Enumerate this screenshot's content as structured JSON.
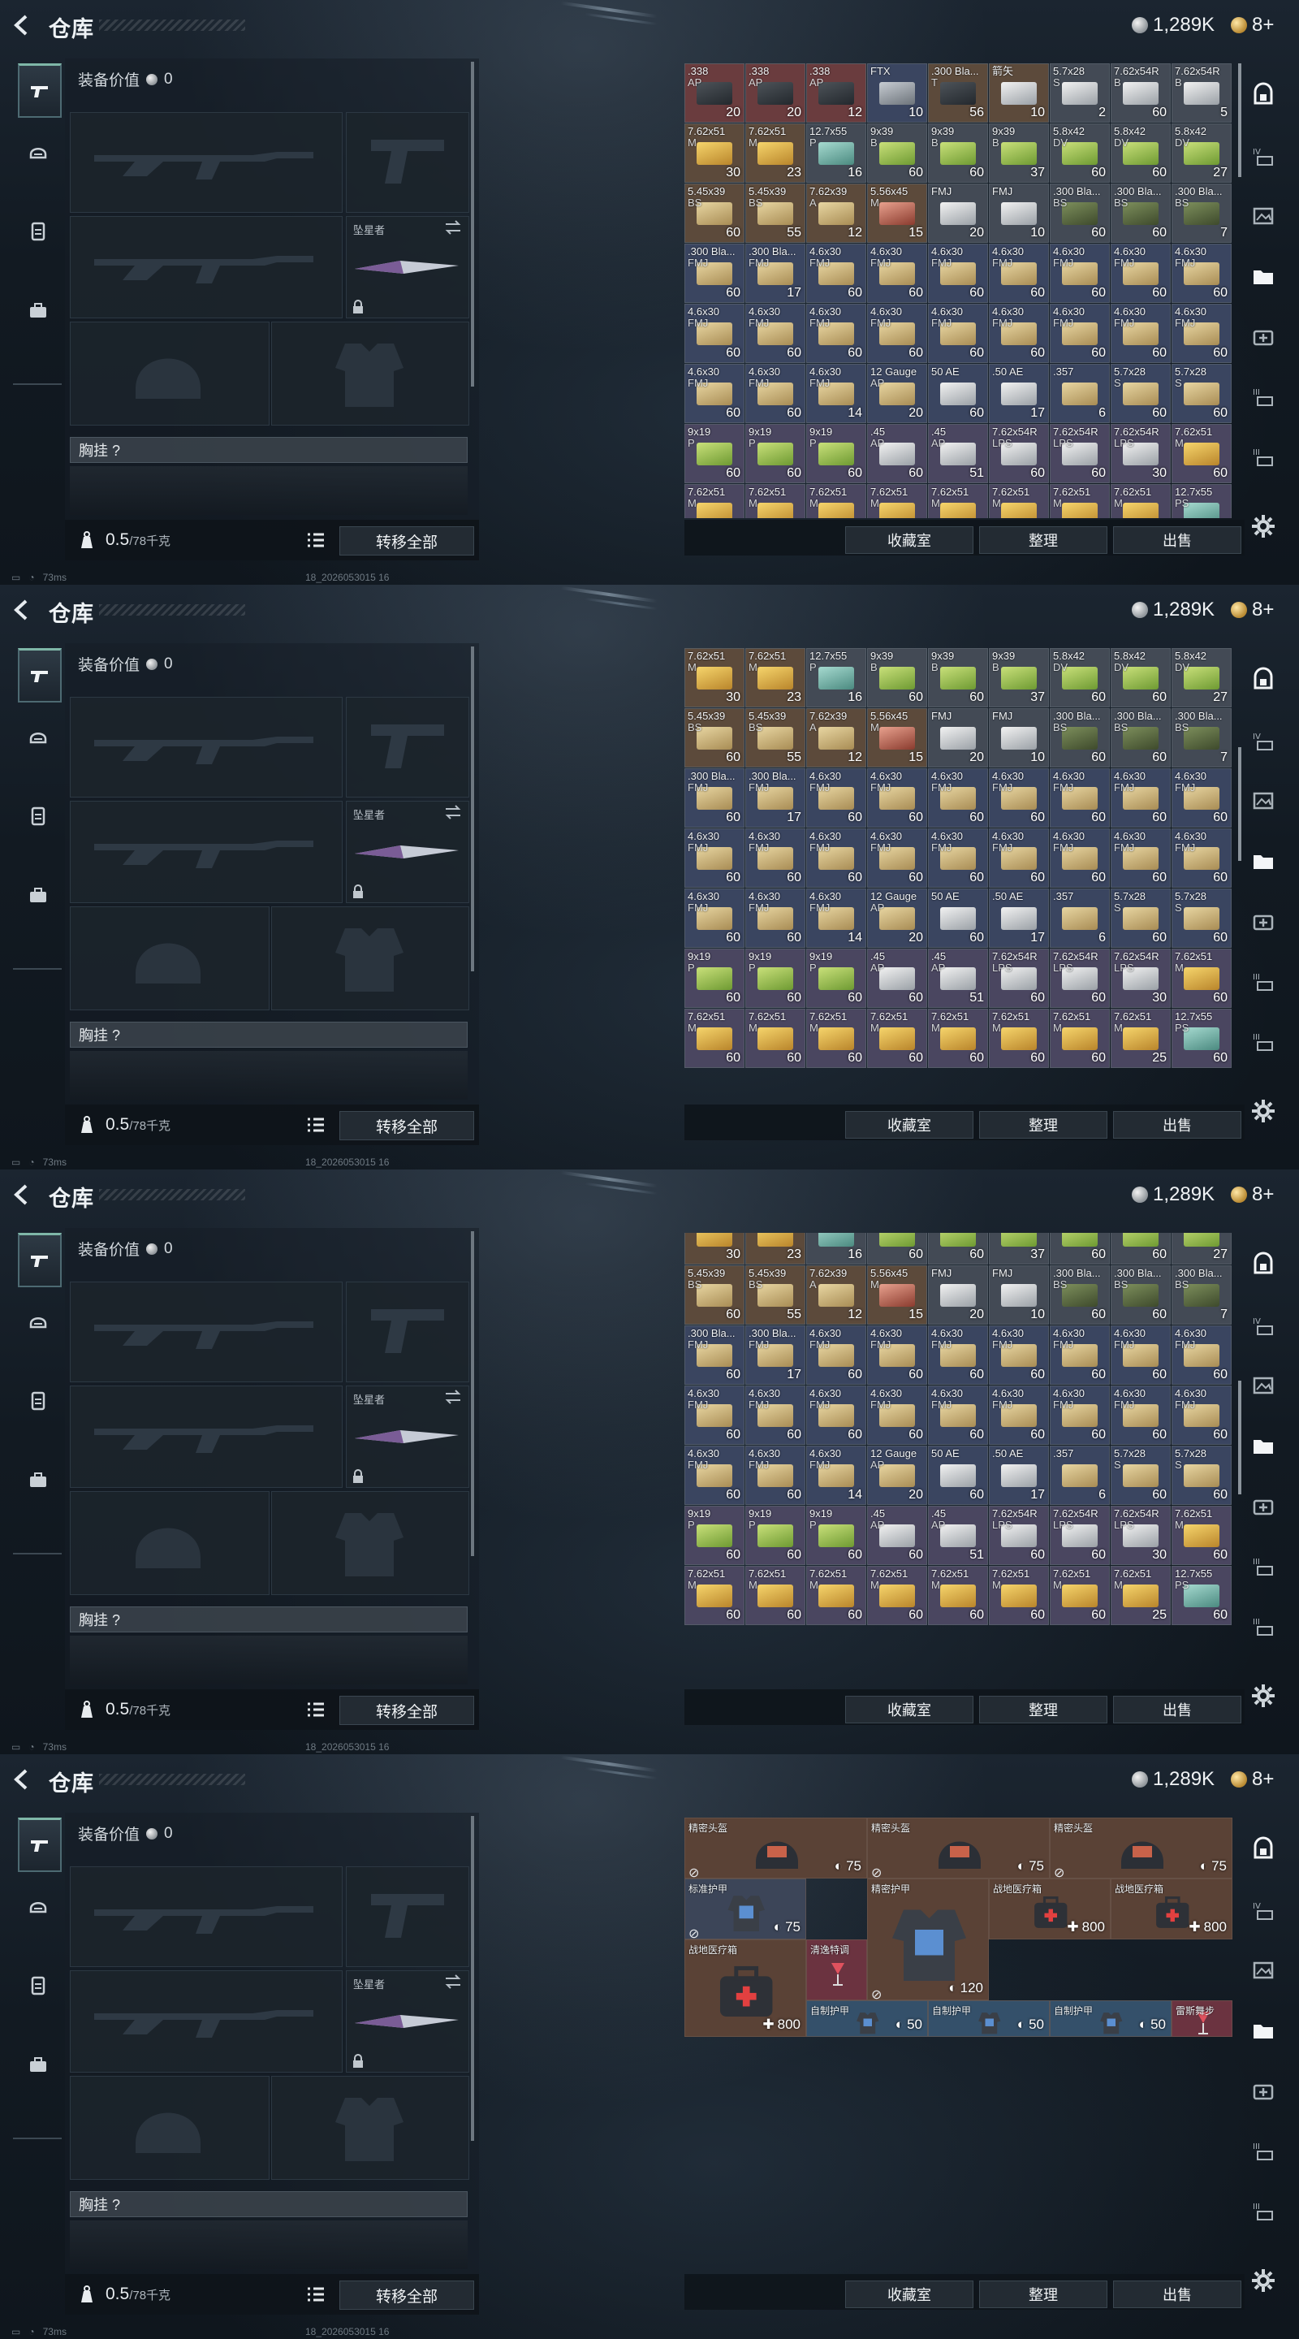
{
  "header": {
    "title": "仓库",
    "currency_silver": "1,289K",
    "currency_gold": "8+"
  },
  "loadout": {
    "value_label": "装备价值",
    "value": "0",
    "melee_name": "坠星者",
    "chest_label": "胸挂 ?",
    "weight": "0.5",
    "weight_max": "/78千克",
    "transfer_all": "转移全部"
  },
  "footer_meta": {
    "ping": "73ms",
    "build": "18_2026053015 16"
  },
  "stash_buttons": {
    "collection": "收藏室",
    "organize": "整理",
    "sell": "出售"
  },
  "ammo_rows": [
    [
      {
        "n": ".338",
        "s": "AP",
        "q": "20",
        "c": "red",
        "b": "dark"
      },
      {
        "n": ".338",
        "s": "AP",
        "q": "20",
        "c": "red",
        "b": "dark"
      },
      {
        "n": ".338",
        "s": "AP",
        "q": "12",
        "c": "red",
        "b": "dark"
      },
      {
        "n": "FTX",
        "s": "",
        "q": "10",
        "c": "blue",
        "b": "gray"
      },
      {
        "n": ".300 Bla...",
        "s": "T",
        "q": "56",
        "c": "brown",
        "b": "dark"
      },
      {
        "n": "箭矢",
        "s": "",
        "q": "10",
        "c": "brown",
        "b": "white"
      },
      {
        "n": "5.7x28",
        "s": "S",
        "q": "2",
        "c": "gray",
        "b": "white"
      },
      {
        "n": "7.62x54R",
        "s": "B",
        "q": "60",
        "c": "gray",
        "b": "white"
      },
      {
        "n": "7.62x54R",
        "s": "B",
        "q": "5",
        "c": "gray",
        "b": "white"
      }
    ],
    [
      {
        "n": "7.62x51",
        "s": "M",
        "q": "30",
        "c": "brown",
        "b": "gold"
      },
      {
        "n": "7.62x51",
        "s": "M",
        "q": "23",
        "c": "brown",
        "b": "gold"
      },
      {
        "n": "12.7x55",
        "s": "P",
        "q": "16",
        "c": "gray",
        "b": "teal"
      },
      {
        "n": "9x39",
        "s": "B",
        "q": "60",
        "c": "gray",
        "b": "green"
      },
      {
        "n": "9x39",
        "s": "B",
        "q": "60",
        "c": "gray",
        "b": "green"
      },
      {
        "n": "9x39",
        "s": "B",
        "q": "37",
        "c": "gray",
        "b": "green"
      },
      {
        "n": "5.8x42",
        "s": "DV",
        "q": "60",
        "c": "gray",
        "b": "green"
      },
      {
        "n": "5.8x42",
        "s": "DV",
        "q": "60",
        "c": "gray",
        "b": "green"
      },
      {
        "n": "5.8x42",
        "s": "DV",
        "q": "27",
        "c": "gray",
        "b": "green"
      }
    ],
    [
      {
        "n": "5.45x39",
        "s": "BS",
        "q": "60",
        "c": "brown",
        "b": "tan"
      },
      {
        "n": "5.45x39",
        "s": "BS",
        "q": "55",
        "c": "brown",
        "b": "tan"
      },
      {
        "n": "7.62x39",
        "s": "A",
        "q": "12",
        "c": "brown",
        "b": "tan"
      },
      {
        "n": "5.56x45",
        "s": "M",
        "q": "15",
        "c": "brown",
        "b": "red"
      },
      {
        "n": "FMJ",
        "s": "",
        "q": "20",
        "c": "gray",
        "b": "white"
      },
      {
        "n": "FMJ",
        "s": "",
        "q": "10",
        "c": "gray",
        "b": "white"
      },
      {
        "n": ".300 Bla...",
        "s": "BS",
        "q": "60",
        "c": "gray",
        "b": "olive"
      },
      {
        "n": ".300 Bla...",
        "s": "BS",
        "q": "60",
        "c": "gray",
        "b": "olive"
      },
      {
        "n": ".300 Bla...",
        "s": "BS",
        "q": "7",
        "c": "gray",
        "b": "olive"
      }
    ],
    [
      {
        "n": ".300 Bla...",
        "s": "FMJ",
        "q": "60",
        "c": "blue",
        "b": "tan"
      },
      {
        "n": ".300 Bla...",
        "s": "FMJ",
        "q": "17",
        "c": "blue",
        "b": "tan"
      },
      {
        "n": "4.6x30",
        "s": "FMJ",
        "q": "60",
        "c": "blue",
        "b": "tan"
      },
      {
        "n": "4.6x30",
        "s": "FMJ",
        "q": "60",
        "c": "blue",
        "b": "tan"
      },
      {
        "n": "4.6x30",
        "s": "FMJ",
        "q": "60",
        "c": "blue",
        "b": "tan"
      },
      {
        "n": "4.6x30",
        "s": "FMJ",
        "q": "60",
        "c": "blue",
        "b": "tan"
      },
      {
        "n": "4.6x30",
        "s": "FMJ",
        "q": "60",
        "c": "blue",
        "b": "tan"
      },
      {
        "n": "4.6x30",
        "s": "FMJ",
        "q": "60",
        "c": "blue",
        "b": "tan"
      },
      {
        "n": "4.6x30",
        "s": "FMJ",
        "q": "60",
        "c": "blue",
        "b": "tan"
      }
    ],
    [
      {
        "n": "4.6x30",
        "s": "FMJ",
        "q": "60",
        "c": "blue",
        "b": "tan"
      },
      {
        "n": "4.6x30",
        "s": "FMJ",
        "q": "60",
        "c": "blue",
        "b": "tan"
      },
      {
        "n": "4.6x30",
        "s": "FMJ",
        "q": "60",
        "c": "blue",
        "b": "tan"
      },
      {
        "n": "4.6x30",
        "s": "FMJ",
        "q": "60",
        "c": "blue",
        "b": "tan"
      },
      {
        "n": "4.6x30",
        "s": "FMJ",
        "q": "60",
        "c": "blue",
        "b": "tan"
      },
      {
        "n": "4.6x30",
        "s": "FMJ",
        "q": "60",
        "c": "blue",
        "b": "tan"
      },
      {
        "n": "4.6x30",
        "s": "FMJ",
        "q": "60",
        "c": "blue",
        "b": "tan"
      },
      {
        "n": "4.6x30",
        "s": "FMJ",
        "q": "60",
        "c": "blue",
        "b": "tan"
      },
      {
        "n": "4.6x30",
        "s": "FMJ",
        "q": "60",
        "c": "blue",
        "b": "tan"
      }
    ],
    [
      {
        "n": "4.6x30",
        "s": "FMJ",
        "q": "60",
        "c": "blue",
        "b": "tan"
      },
      {
        "n": "4.6x30",
        "s": "FMJ",
        "q": "60",
        "c": "blue",
        "b": "tan"
      },
      {
        "n": "4.6x30",
        "s": "FMJ",
        "q": "14",
        "c": "blue",
        "b": "tan"
      },
      {
        "n": "12 Gauge",
        "s": "AP",
        "q": "20",
        "c": "blue",
        "b": "tan"
      },
      {
        "n": "50 AE",
        "s": "",
        "q": "60",
        "c": "blue",
        "b": "white"
      },
      {
        "n": ".50 AE",
        "s": "",
        "q": "17",
        "c": "blue",
        "b": "white"
      },
      {
        "n": ".357",
        "s": "",
        "q": "6",
        "c": "blue",
        "b": "tan"
      },
      {
        "n": "5.7x28",
        "s": "S",
        "q": "60",
        "c": "blue",
        "b": "tan"
      },
      {
        "n": "5.7x28",
        "s": "S",
        "q": "60",
        "c": "blue",
        "b": "tan"
      }
    ],
    [
      {
        "n": "9x19",
        "s": "P",
        "q": "60",
        "c": "purple",
        "b": "green"
      },
      {
        "n": "9x19",
        "s": "P",
        "q": "60",
        "c": "purple",
        "b": "green"
      },
      {
        "n": "9x19",
        "s": "P",
        "q": "60",
        "c": "purple",
        "b": "green"
      },
      {
        "n": ".45",
        "s": "AP",
        "q": "60",
        "c": "purple",
        "b": "white"
      },
      {
        "n": ".45",
        "s": "AP",
        "q": "51",
        "c": "purple",
        "b": "white"
      },
      {
        "n": "7.62x54R",
        "s": "LPS",
        "q": "60",
        "c": "purple",
        "b": "white"
      },
      {
        "n": "7.62x54R",
        "s": "LPS",
        "q": "60",
        "c": "purple",
        "b": "white"
      },
      {
        "n": "7.62x54R",
        "s": "LPS",
        "q": "30",
        "c": "purple",
        "b": "white"
      },
      {
        "n": "7.62x51",
        "s": "M",
        "q": "60",
        "c": "purple",
        "b": "gold"
      }
    ],
    [
      {
        "n": "7.62x51",
        "s": "M",
        "q": "60",
        "c": "purple",
        "b": "gold"
      },
      {
        "n": "7.62x51",
        "s": "M",
        "q": "60",
        "c": "purple",
        "b": "gold"
      },
      {
        "n": "7.62x51",
        "s": "M",
        "q": "60",
        "c": "purple",
        "b": "gold"
      },
      {
        "n": "7.62x51",
        "s": "M",
        "q": "60",
        "c": "purple",
        "b": "gold"
      },
      {
        "n": "7.62x51",
        "s": "M",
        "q": "60",
        "c": "purple",
        "b": "gold"
      },
      {
        "n": "7.62x51",
        "s": "M",
        "q": "60",
        "c": "purple",
        "b": "gold"
      },
      {
        "n": "7.62x51",
        "s": "M",
        "q": "60",
        "c": "purple",
        "b": "gold"
      },
      {
        "n": "7.62x51",
        "s": "M",
        "q": "25",
        "c": "purple",
        "b": "gold"
      },
      {
        "n": "12.7x55",
        "s": "PS",
        "q": "60",
        "c": "purple",
        "b": "teal"
      }
    ]
  ],
  "gear_items": [
    {
      "n": "精密头盔",
      "v": "75",
      "kind": "helmet",
      "c": "#5a4236"
    },
    {
      "n": "精密头盔",
      "v": "75",
      "kind": "helmet",
      "c": "#5a4236"
    },
    {
      "n": "精密头盔",
      "v": "75",
      "kind": "helmet",
      "c": "#5a4236"
    },
    {
      "n": "标准护甲",
      "v": "75",
      "kind": "armor",
      "c": "#3c4558"
    },
    {
      "n": "精密护甲",
      "v": "120",
      "kind": "armor",
      "c": "#5a4236"
    },
    {
      "n": "战地医疗箱",
      "v": "800",
      "kind": "medkit",
      "c": "#5a4236"
    },
    {
      "n": "战地医疗箱",
      "v": "800",
      "kind": "medkit",
      "c": "#5a4236"
    },
    {
      "n": "战地医疗箱",
      "v": "800",
      "kind": "medkit",
      "c": "#5a4236"
    },
    {
      "n": "清逸特调",
      "v": "",
      "kind": "drink",
      "c": "#6b3340"
    },
    {
      "n": "自制护甲",
      "v": "50",
      "kind": "armor",
      "c": "#34506a"
    },
    {
      "n": "自制护甲",
      "v": "50",
      "kind": "armor",
      "c": "#34506a"
    },
    {
      "n": "自制护甲",
      "v": "50",
      "kind": "armor",
      "c": "#34506a"
    },
    {
      "n": "雷斯舞步",
      "v": "",
      "kind": "drink",
      "c": "#6b3340"
    }
  ]
}
